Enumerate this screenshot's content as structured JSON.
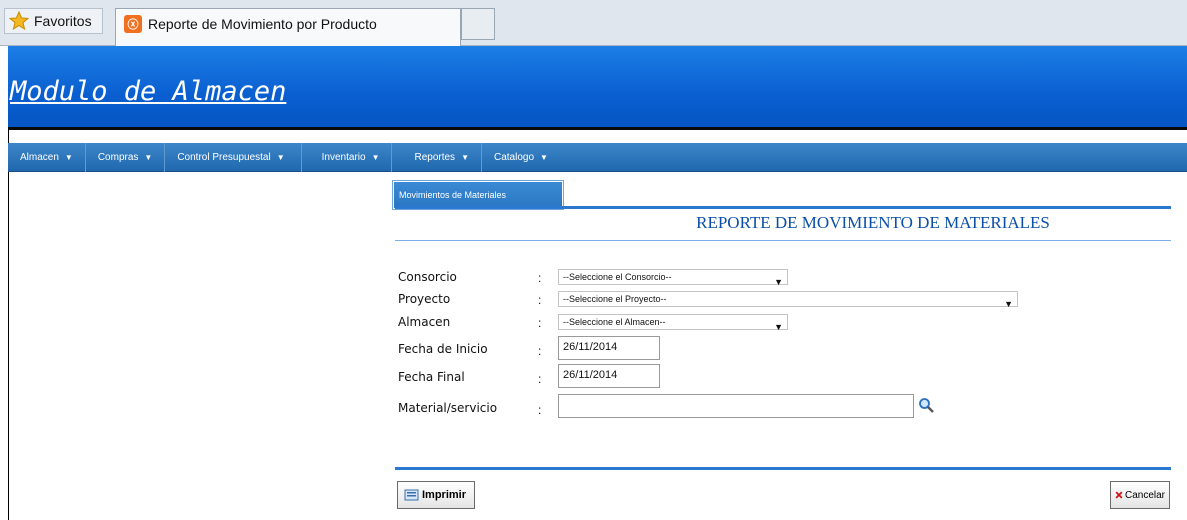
{
  "browser": {
    "favorites_label": "Favoritos",
    "active_tab_title": "Reporte de Movimiento por Producto"
  },
  "header": {
    "app_title": "Modulo de Almacen",
    "accent_color": "#0a5fd0"
  },
  "menu": {
    "items": [
      {
        "label": "Almacen"
      },
      {
        "label": "Compras"
      },
      {
        "label": "Control Presupuestal"
      },
      {
        "label": "Inventario"
      },
      {
        "label": "Reportes"
      },
      {
        "label": "Catalogo"
      }
    ],
    "dropdown_item": "Movimientos de Materiales"
  },
  "report": {
    "title": "REPORTE DE MOVIMIENTO DE MATERIALES",
    "fields": {
      "consorcio": {
        "label": "Consorcio",
        "value": "--Seleccione el Consorcio--"
      },
      "proyecto": {
        "label": "Proyecto",
        "value": "--Seleccione el Proyecto--"
      },
      "almacen": {
        "label": "Almacen",
        "value": "--Seleccione el Almacen--"
      },
      "fecha_inicio": {
        "label": "Fecha de Inicio",
        "value": "26/11/2014"
      },
      "fecha_final": {
        "label": "Fecha Final",
        "value": "26/11/2014"
      },
      "material": {
        "label": "Material/servicio",
        "value": ""
      }
    },
    "colon": ":"
  },
  "buttons": {
    "print_label": "Imprimir",
    "cancel_label": "Cancelar"
  }
}
